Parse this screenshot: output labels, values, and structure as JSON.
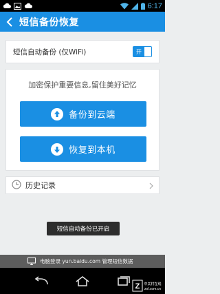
{
  "status_bar": {
    "time": "6:17"
  },
  "app_bar": {
    "title": "短信备份恢复"
  },
  "auto_backup": {
    "label": "短信自动备份 (仅WiFi)",
    "toggle_label": "开",
    "enabled": true
  },
  "main": {
    "tagline": "加密保护重要信息,留住美好记忆",
    "backup_button": "备份到云端",
    "restore_button": "恢复到本机"
  },
  "history": {
    "label": "历史记录"
  },
  "toast": {
    "message": "短信自动备份已开启"
  },
  "footer": {
    "text": "电脑登录 yun.baidu.com 管理短信数据"
  },
  "watermark": {
    "line1": "中关村在线",
    "line2": "zol.com.cn"
  },
  "colors": {
    "primary": "#1a8fe3",
    "background": "#eceeef",
    "footer": "#5d5d5d"
  }
}
